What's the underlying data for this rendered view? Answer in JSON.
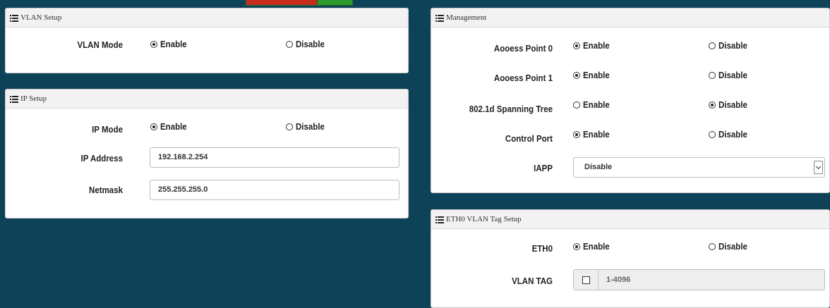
{
  "vlan_setup": {
    "title": "VLAN Setup",
    "vlan_mode": {
      "label": "VLAN Mode",
      "enable": "Enable",
      "disable": "Disable",
      "selected": "enable"
    }
  },
  "ip_setup": {
    "title": "IP Setup",
    "ip_mode": {
      "label": "IP Mode",
      "enable": "Enable",
      "disable": "Disable",
      "selected": "enable"
    },
    "ip_address": {
      "label": "IP Address",
      "value": "192.168.2.254"
    },
    "netmask": {
      "label": "Netmask",
      "value": "255.255.255.0"
    }
  },
  "management": {
    "title": "Management",
    "rows": [
      {
        "label": "Aooess Point 0",
        "enable": "Enable",
        "disable": "Disable",
        "selected": "enable"
      },
      {
        "label": "Aooess Point 1",
        "enable": "Enable",
        "disable": "Disable",
        "selected": "enable"
      },
      {
        "label": "802.1d Spanning Tree",
        "enable": "Enable",
        "disable": "Disable",
        "selected": "disable"
      },
      {
        "label": "Control Port",
        "enable": "Enable",
        "disable": "Disable",
        "selected": "enable"
      }
    ],
    "iapp": {
      "label": "IAPP",
      "value": "Disable"
    }
  },
  "eth0_vlan": {
    "title": "ETH0 VLAN Tag Setup",
    "eth0": {
      "label": "ETH0",
      "enable": "Enable",
      "disable": "Disable",
      "selected": "enable"
    },
    "vlan_tag": {
      "label": "VLAN TAG",
      "checked": false,
      "placeholder": "1-4096"
    }
  }
}
